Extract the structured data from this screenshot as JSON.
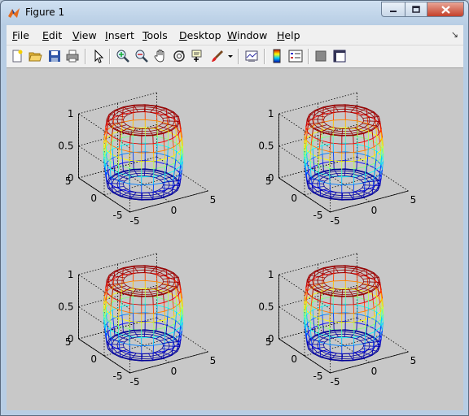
{
  "window": {
    "title": "Figure 1"
  },
  "menu": [
    {
      "id": "file",
      "label": "File",
      "u": "F",
      "rest": "ile"
    },
    {
      "id": "edit",
      "label": "Edit",
      "u": "E",
      "rest": "dit"
    },
    {
      "id": "view",
      "label": "View",
      "u": "V",
      "rest": "iew"
    },
    {
      "id": "insert",
      "label": "Insert",
      "u": "I",
      "rest": "nsert"
    },
    {
      "id": "tools",
      "label": "Tools",
      "u": "T",
      "rest": "ools"
    },
    {
      "id": "desktop",
      "label": "Desktop",
      "u": "D",
      "rest": "esktop"
    },
    {
      "id": "window",
      "label": "Window",
      "u": "W",
      "rest": "indow"
    },
    {
      "id": "help",
      "label": "Help",
      "u": "H",
      "rest": "elp"
    }
  ],
  "toolbar": [
    "new-figure-icon",
    "open-file-icon",
    "save-icon",
    "print-icon",
    "edit-plot-arrow-icon",
    "zoom-in-icon",
    "zoom-out-icon",
    "pan-hand-icon",
    "rotate-3d-icon",
    "data-cursor-icon",
    "brush-icon",
    "brush-dropdown-icon",
    "link-plot-icon",
    "insert-colorbar-icon",
    "insert-legend-icon",
    "hide-plot-tools-icon",
    "show-plot-tools-icon"
  ],
  "subplots": [
    {
      "id": "tl",
      "z_ticks": [
        "1",
        "0.5",
        "0"
      ],
      "y_ticks": [
        "5",
        "0",
        "-5"
      ],
      "x_ticks": [
        "-5",
        "0",
        "5"
      ]
    },
    {
      "id": "tr",
      "z_ticks": [
        "1",
        "0.5",
        "0"
      ],
      "y_ticks": [
        "5",
        "0",
        "-5"
      ],
      "x_ticks": [
        "-5",
        "0",
        "5"
      ]
    },
    {
      "id": "bl",
      "z_ticks": [
        "1",
        "0.5",
        "0"
      ],
      "y_ticks": [
        "5",
        "0",
        "-5"
      ],
      "x_ticks": [
        "-5",
        "0",
        "5"
      ]
    },
    {
      "id": "br",
      "z_ticks": [
        "1",
        "0.5",
        "0"
      ],
      "y_ticks": [
        "5",
        "0",
        "-5"
      ],
      "x_ticks": [
        "-5",
        "0",
        "5"
      ]
    }
  ],
  "chart_data": {
    "type": "mesh3d",
    "description_free": true,
    "zlim": [
      0,
      1
    ],
    "xlim": [
      -5,
      5
    ],
    "ylim": [
      -5,
      5
    ],
    "colormap": "jet",
    "grid": true
  }
}
